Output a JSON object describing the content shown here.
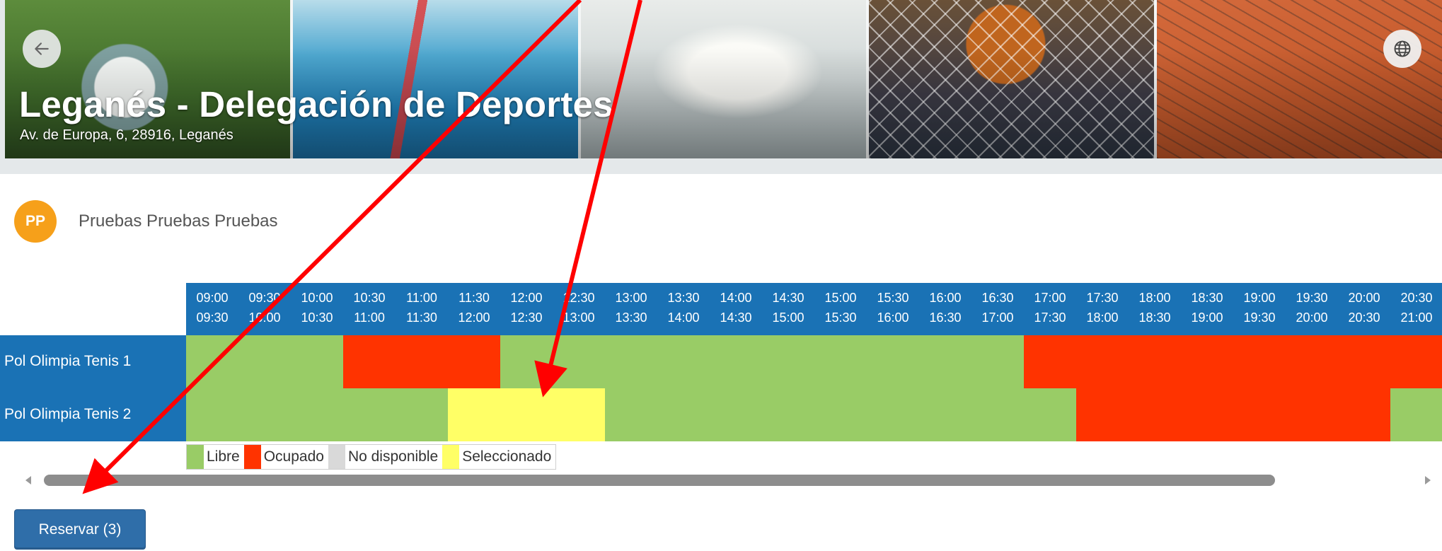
{
  "header": {
    "title": "Leganés - Delegación de Deportes",
    "address": "Av. de Europa, 6, 28916, Leganés",
    "back_icon": "arrow-left-icon",
    "language_icon": "globe-icon"
  },
  "user": {
    "initials": "PP",
    "name": "Pruebas Pruebas Pruebas",
    "avatar_color": "#f6a01a"
  },
  "schedule": {
    "slots": [
      {
        "start": "09:00",
        "end": "09:30"
      },
      {
        "start": "09:30",
        "end": "10:00"
      },
      {
        "start": "10:00",
        "end": "10:30"
      },
      {
        "start": "10:30",
        "end": "11:00"
      },
      {
        "start": "11:00",
        "end": "11:30"
      },
      {
        "start": "11:30",
        "end": "12:00"
      },
      {
        "start": "12:00",
        "end": "12:30"
      },
      {
        "start": "12:30",
        "end": "13:00"
      },
      {
        "start": "13:00",
        "end": "13:30"
      },
      {
        "start": "13:30",
        "end": "14:00"
      },
      {
        "start": "14:00",
        "end": "14:30"
      },
      {
        "start": "14:30",
        "end": "15:00"
      },
      {
        "start": "15:00",
        "end": "15:30"
      },
      {
        "start": "15:30",
        "end": "16:00"
      },
      {
        "start": "16:00",
        "end": "16:30"
      },
      {
        "start": "16:30",
        "end": "17:00"
      },
      {
        "start": "17:00",
        "end": "17:30"
      },
      {
        "start": "17:30",
        "end": "18:00"
      },
      {
        "start": "18:00",
        "end": "18:30"
      },
      {
        "start": "18:30",
        "end": "19:00"
      },
      {
        "start": "19:00",
        "end": "19:30"
      },
      {
        "start": "19:30",
        "end": "20:00"
      },
      {
        "start": "20:00",
        "end": "20:30"
      },
      {
        "start": "20:30",
        "end": "21:00"
      }
    ],
    "courts": [
      {
        "name": "Pol Olimpia Tenis 1",
        "states": [
          "libre",
          "libre",
          "libre",
          "ocupado",
          "ocupado",
          "ocupado",
          "libre",
          "libre",
          "libre",
          "libre",
          "libre",
          "libre",
          "libre",
          "libre",
          "libre",
          "libre",
          "ocupado",
          "ocupado",
          "ocupado",
          "ocupado",
          "ocupado",
          "ocupado",
          "ocupado",
          "ocupado"
        ]
      },
      {
        "name": "Pol Olimpia Tenis 2",
        "states": [
          "libre",
          "libre",
          "libre",
          "libre",
          "libre",
          "seleccionado",
          "seleccionado",
          "seleccionado",
          "libre",
          "libre",
          "libre",
          "libre",
          "libre",
          "libre",
          "libre",
          "libre",
          "libre",
          "ocupado",
          "ocupado",
          "ocupado",
          "ocupado",
          "ocupado",
          "ocupado",
          "libre"
        ]
      }
    ]
  },
  "legend": [
    {
      "key": "libre",
      "label": "Libre",
      "color": "#99cc66"
    },
    {
      "key": "ocupado",
      "label": "Ocupado",
      "color": "#ff3300"
    },
    {
      "key": "no_disponible",
      "label": "No disponible",
      "color": "#d9d9d9"
    },
    {
      "key": "seleccionado",
      "label": "Seleccionado",
      "color": "#ffff66"
    }
  ],
  "actions": {
    "reserve_label": "Reservar (3)"
  },
  "colors": {
    "header_blue": "#1a72b5",
    "annotation_red": "#ff0000",
    "button_blue": "#2f6ea9"
  }
}
